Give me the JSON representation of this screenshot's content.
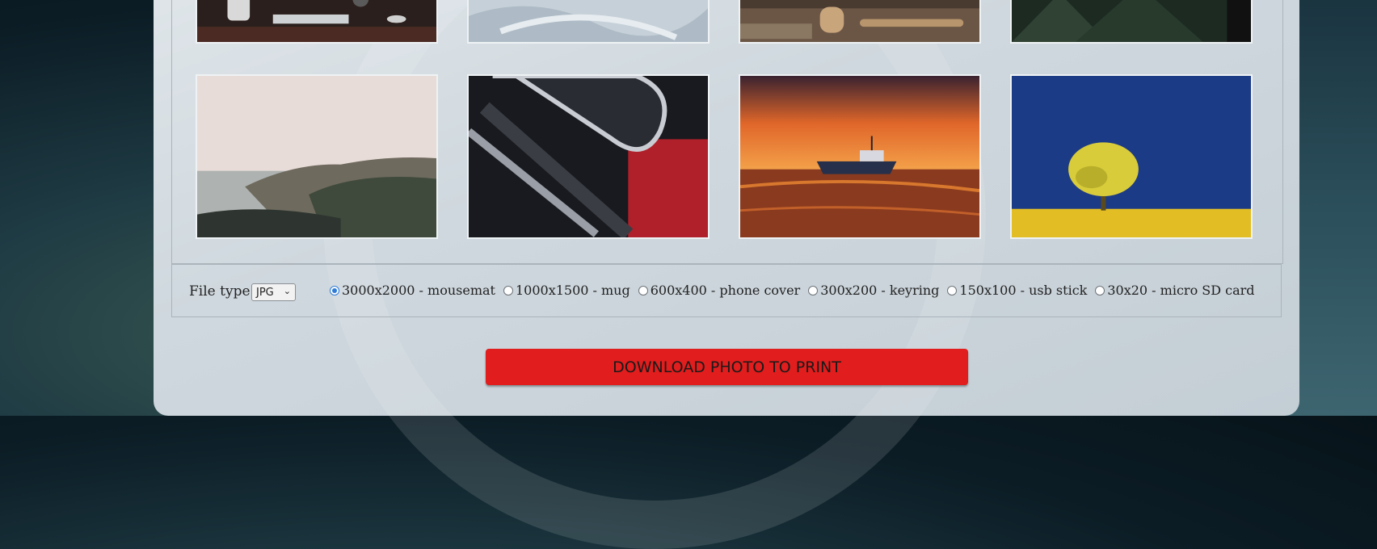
{
  "gallery": {
    "top_row": [
      {
        "name": "desk-setup"
      },
      {
        "name": "ice-closeup"
      },
      {
        "name": "woodwork-tools"
      },
      {
        "name": "dark-foliage"
      }
    ],
    "bottom_row": [
      {
        "name": "misty-coast"
      },
      {
        "name": "red-chrome-abstract"
      },
      {
        "name": "sunset-boat"
      },
      {
        "name": "yellow-tree-field"
      }
    ]
  },
  "controls": {
    "file_type_label": "File type",
    "file_type_value": "JPG",
    "sizes": [
      {
        "label": "3000x2000 - mousemat",
        "checked": true
      },
      {
        "label": "1000x1500 - mug",
        "checked": false
      },
      {
        "label": "600x400 - phone cover",
        "checked": false
      },
      {
        "label": "300x200 - keyring",
        "checked": false
      },
      {
        "label": "150x100 - usb stick",
        "checked": false
      },
      {
        "label": "30x20 - micro SD card",
        "checked": false
      }
    ]
  },
  "download_button": "DOWNLOAD PHOTO TO PRINT",
  "colors": {
    "accent_button": "#e11d1d",
    "radio_checked": "#2f7bd6"
  }
}
